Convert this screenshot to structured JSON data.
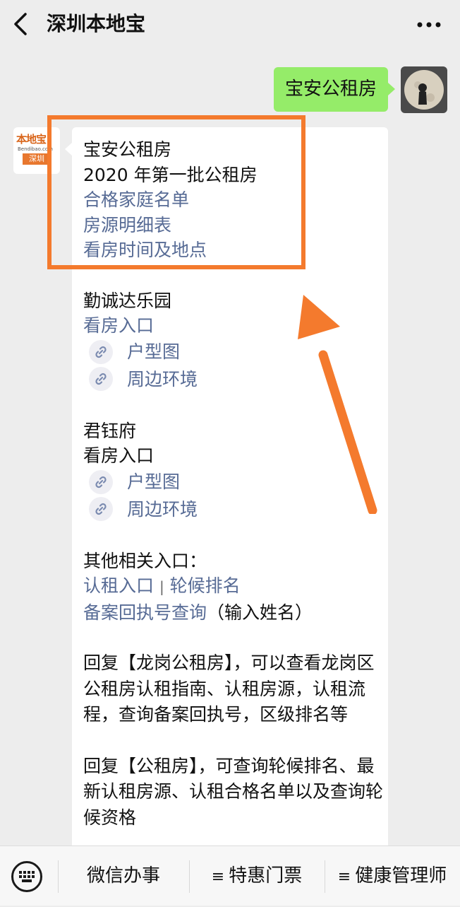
{
  "header": {
    "title": "深圳本地宝"
  },
  "outgoing_message": "宝安公租房",
  "bot_avatar": {
    "logo_text": "本地宝",
    "logo_sub": "Bendibao.com",
    "city": "深圳"
  },
  "reply": {
    "intro": [
      {
        "text": "宝安公租房",
        "link": false
      },
      {
        "text": "2020 年第一批公租房",
        "link": false
      },
      {
        "text": "合格家庭名单",
        "link": true
      },
      {
        "text": "房源明细表",
        "link": true
      },
      {
        "text": "看房时间及地点",
        "link": true
      }
    ],
    "section1": {
      "title": "勤诚达乐园",
      "entry": "看房入口",
      "mini1": "户型图",
      "mini2": "周边环境"
    },
    "section2": {
      "title": "君钰府",
      "entry": "看房入口",
      "mini1": "户型图",
      "mini2": "周边环境"
    },
    "other": {
      "title": "其他相关入口：",
      "link_a": "认租入口",
      "separator": "|",
      "link_b": "轮候排名",
      "link_c": "备案回执号查询",
      "note": "（输入姓名）"
    },
    "para1": "回复【龙岗公租房】，可以查看龙岗区公租房认租指南、认租房源，认租流程，查询备案回执号，区级排名等",
    "para2": "回复【公租房】，可查询轮候排名、最新认租房源、认租合格名单以及查询轮候资格"
  },
  "bottom_menu": [
    {
      "label": "微信办事",
      "has_menu_icon": false
    },
    {
      "label": "特惠门票",
      "has_menu_icon": true
    },
    {
      "label": "健康管理师",
      "has_menu_icon": true
    }
  ],
  "colors": {
    "background": "#ededed",
    "outgoing_bubble": "#95ec69",
    "link": "#576b95",
    "highlight": "#f47a2d"
  }
}
